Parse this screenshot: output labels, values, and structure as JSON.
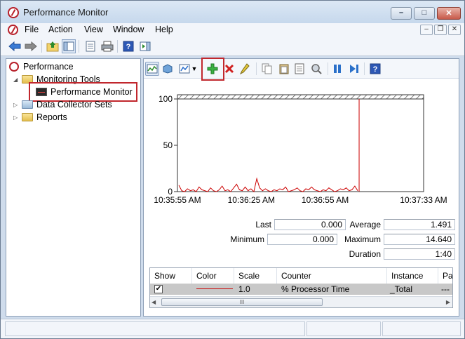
{
  "window": {
    "title": "Performance Monitor"
  },
  "caption_buttons": {
    "minimize": "–",
    "maximize": "□",
    "close": "✕"
  },
  "menu": [
    "File",
    "Action",
    "View",
    "Window",
    "Help"
  ],
  "mdi": {
    "minimize": "–",
    "restore": "❐",
    "close": "✕"
  },
  "tree": {
    "root": "Performance",
    "items": [
      {
        "label": "Monitoring Tools",
        "expanded": true
      },
      {
        "label": "Performance Monitor",
        "selected": true
      },
      {
        "label": "Data Collector Sets",
        "expanded": false
      },
      {
        "label": "Reports",
        "expanded": false
      }
    ]
  },
  "chart_data": {
    "type": "line",
    "y_ticks": [
      "100",
      "50",
      "0"
    ],
    "ylim": [
      0,
      100
    ],
    "x_ticks": [
      "10:35:55 AM",
      "10:36:25 AM",
      "10:36:55 AM",
      "10:37:33 AM"
    ],
    "cursor_position": 0.738,
    "series": [
      {
        "color": "#cc0000",
        "values": [
          7,
          1,
          0,
          3,
          1,
          2,
          0,
          5,
          2,
          1,
          0,
          4,
          1,
          0,
          2,
          6,
          1,
          2,
          0,
          4,
          8,
          2,
          1,
          5,
          1,
          3,
          0,
          14,
          4,
          1,
          3,
          1,
          0,
          2,
          1,
          3,
          2,
          5,
          0,
          1,
          2,
          4,
          1,
          0,
          3,
          2,
          5,
          2,
          1,
          0,
          2,
          1,
          4,
          2,
          0,
          1,
          3,
          2,
          4,
          1,
          2,
          6,
          1
        ]
      }
    ]
  },
  "stats": {
    "last_label": "Last",
    "last_value": "0.000",
    "average_label": "Average",
    "average_value": "1.491",
    "minimum_label": "Minimum",
    "minimum_value": "0.000",
    "maximum_label": "Maximum",
    "maximum_value": "14.640",
    "duration_label": "Duration",
    "duration_value": "1:40"
  },
  "counters": {
    "headers": [
      "Show",
      "Color",
      "Scale",
      "Counter",
      "Instance",
      "Pa"
    ],
    "rows": [
      {
        "show": "✔",
        "color": "#cc0000",
        "scale": "1.0",
        "counter": "% Processor Time",
        "instance": "_Total",
        "parent": "---"
      }
    ],
    "scroll_grip": "III"
  },
  "colors": {
    "highlight": "#c1272d",
    "series": "#cc0000"
  }
}
